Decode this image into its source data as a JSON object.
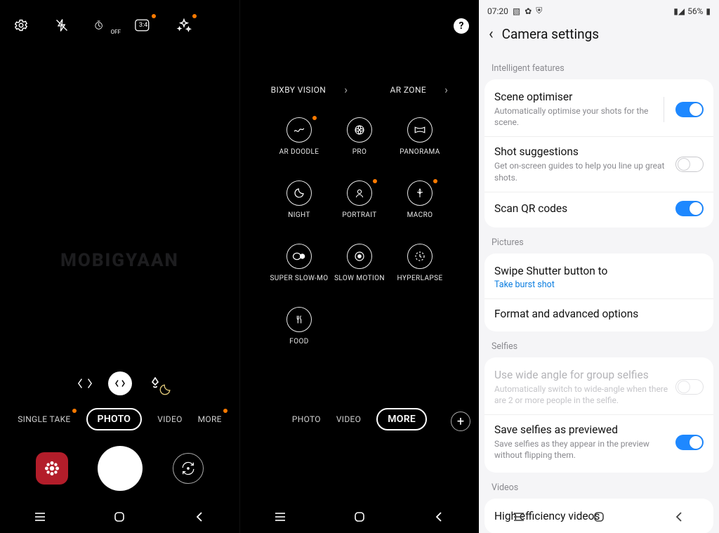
{
  "cameraA": {
    "modes": {
      "single_take": "SINGLE TAKE",
      "photo": "PHOTO",
      "video": "VIDEO",
      "more": "MORE"
    },
    "aspect_label": "3:4",
    "timer_label": "OFF"
  },
  "cameraB": {
    "links": {
      "bixby": "BIXBY VISION",
      "arzone": "AR ZONE"
    },
    "grid": {
      "ar_doodle": "AR DOODLE",
      "pro": "PRO",
      "panorama": "PANORAMA",
      "night": "NIGHT",
      "portrait": "PORTRAIT",
      "macro": "MACRO",
      "super_slow": "SUPER SLOW-MO",
      "slow_motion": "SLOW MOTION",
      "hyperlapse": "HYPERLAPSE",
      "food": "FOOD"
    },
    "modestrip": {
      "photo": "PHOTO",
      "video": "VIDEO",
      "more": "MORE"
    }
  },
  "watermark": "MOBIGYAAN",
  "settings": {
    "status": {
      "time": "07:20",
      "battery": "56%"
    },
    "title": "Camera settings",
    "sections": {
      "intelligent": "Intelligent features",
      "pictures": "Pictures",
      "selfies": "Selfies",
      "videos": "Videos"
    },
    "items": {
      "scene_opt": {
        "title": "Scene optimiser",
        "sub": "Automatically optimise your shots for the scene."
      },
      "shot_sugg": {
        "title": "Shot suggestions",
        "sub": "Get on-screen guides to help you line up great shots."
      },
      "scan_qr": {
        "title": "Scan QR codes"
      },
      "swipe_shutter": {
        "title": "Swipe Shutter button to",
        "val": "Take burst shot"
      },
      "format_adv": {
        "title": "Format and advanced options"
      },
      "wide_selfie": {
        "title": "Use wide angle for group selfies",
        "sub": "Automatically switch to wide-angle when there are 2 or more people in the selfie."
      },
      "save_preview": {
        "title": "Save selfies as previewed",
        "sub": "Save selfies as they appear in the preview without flipping them."
      },
      "high_eff": {
        "title": "High efficiency videos"
      }
    }
  }
}
